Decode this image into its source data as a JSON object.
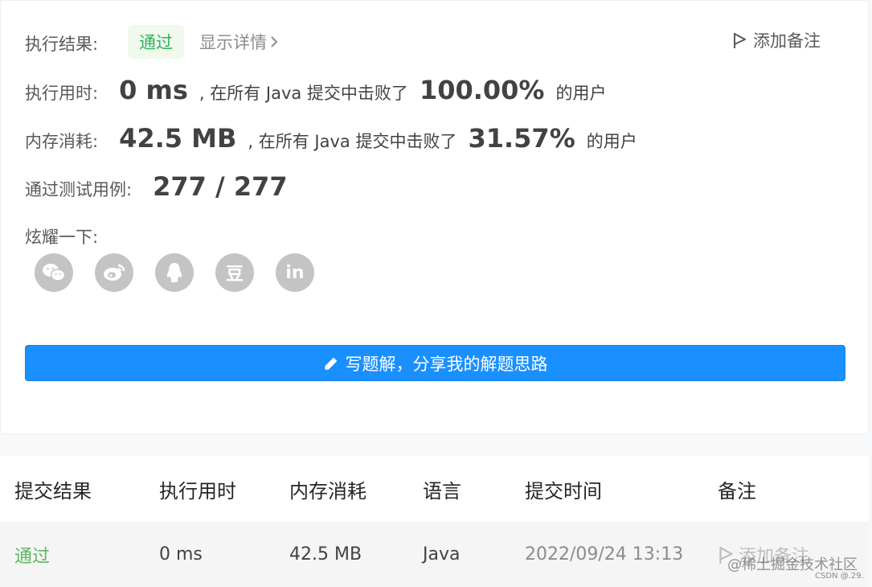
{
  "result": {
    "label": "执行结果:",
    "status": "通过",
    "details_link": "显示详情",
    "add_note": "添加备注"
  },
  "runtime": {
    "label": "执行用时:",
    "value": "0 ms",
    "prefix": ", 在所有 Java 提交中击败了",
    "percent": "100.00%",
    "suffix": "的用户"
  },
  "memory": {
    "label": "内存消耗:",
    "value": "42.5 MB",
    "prefix": ", 在所有 Java 提交中击败了",
    "percent": "31.57%",
    "suffix": "的用户"
  },
  "tests": {
    "label": "通过测试用例:",
    "value": "277 / 277"
  },
  "share": {
    "label": "炫耀一下:",
    "icons": [
      "wechat-icon",
      "weibo-icon",
      "qq-icon",
      "douban-icon",
      "linkedin-icon"
    ],
    "douban_glyph": "豆",
    "linkedin_glyph": "in"
  },
  "write_button": "写题解，分享我的解题思路",
  "table": {
    "headers": [
      "提交结果",
      "执行用时",
      "内存消耗",
      "语言",
      "提交时间",
      "备注"
    ],
    "rows": [
      {
        "status": "通过",
        "runtime": "0 ms",
        "memory": "42.5 MB",
        "language": "Java",
        "time": "2022/09/24 13:13",
        "note": "添加备注"
      }
    ]
  },
  "watermark": "@稀土掘金技术社区",
  "csdn_mark": "CSDN @.29.",
  "colors": {
    "accent_blue": "#1a90ff",
    "pass_green": "#2db55d",
    "table_pass_green": "#5cb85c"
  }
}
